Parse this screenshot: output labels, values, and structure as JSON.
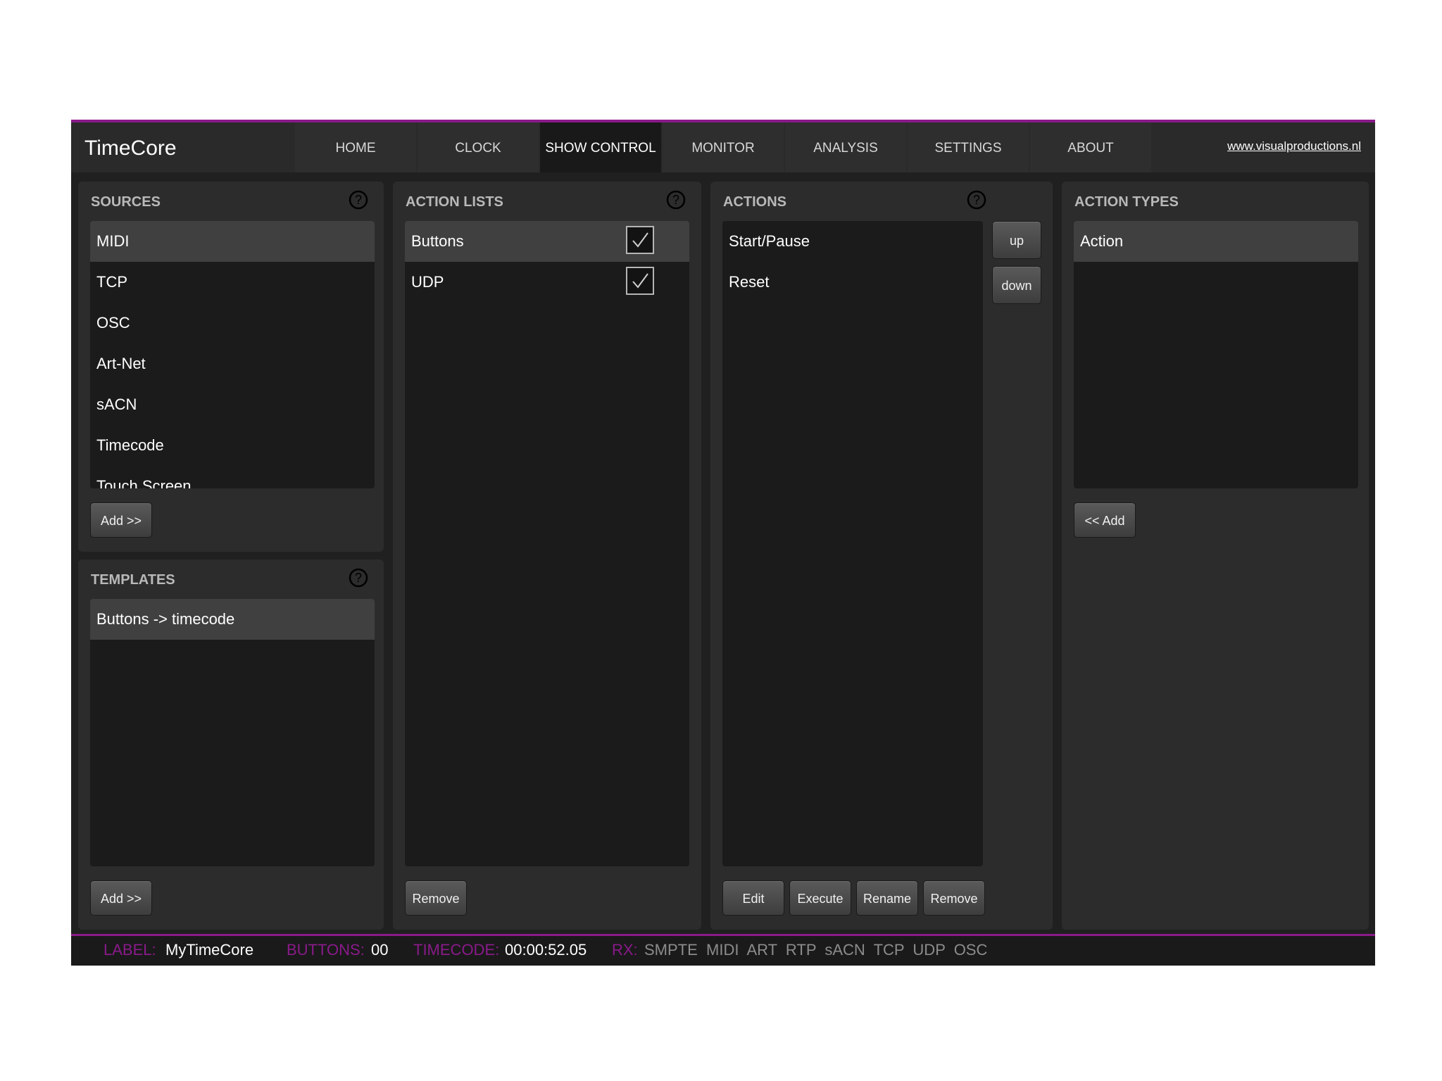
{
  "app_title": "TimeCore",
  "nav": {
    "tabs": [
      "HOME",
      "CLOCK",
      "SHOW CONTROL",
      "MONITOR",
      "ANALYSIS",
      "SETTINGS",
      "ABOUT"
    ],
    "active_tab": "SHOW CONTROL",
    "site_link": "www.visualproductions.nl"
  },
  "sources": {
    "title": "SOURCES",
    "items": [
      "MIDI",
      "TCP",
      "OSC",
      "Art-Net",
      "sACN",
      "Timecode",
      "Touch Screen"
    ],
    "selected": "MIDI",
    "add_label": "Add >>"
  },
  "templates": {
    "title": "TEMPLATES",
    "items": [
      "Buttons -> timecode"
    ],
    "add_label": "Add >>"
  },
  "action_lists": {
    "title": "ACTION LISTS",
    "items": [
      {
        "label": "Buttons",
        "checked": true
      },
      {
        "label": "UDP",
        "checked": true
      }
    ],
    "remove_label": "Remove"
  },
  "actions": {
    "title": "ACTIONS",
    "items": [
      "Start/Pause",
      "Reset"
    ],
    "up_label": "up",
    "down_label": "down",
    "edit_label": "Edit",
    "execute_label": "Execute",
    "rename_label": "Rename",
    "remove_label": "Remove"
  },
  "action_types": {
    "title": "ACTION TYPES",
    "items": [
      "Action"
    ],
    "add_label": "<< Add"
  },
  "status": {
    "label_key": "LABEL:",
    "label_value": "MyTimeCore",
    "buttons_key": "BUTTONS:",
    "buttons_value": "00",
    "timecode_key": "TIMECODE:",
    "timecode_value": "00:00:52.05",
    "rx_key": "RX:",
    "rx_value": "SMPTE  MIDI  ART  RTP  sACN  TCP  UDP  OSC"
  },
  "colors": {
    "accent": "#8a1a8a",
    "background": "#202020",
    "panel": "#2c2c2c",
    "list": "#1b1b1b",
    "selected_row": "#404040"
  }
}
